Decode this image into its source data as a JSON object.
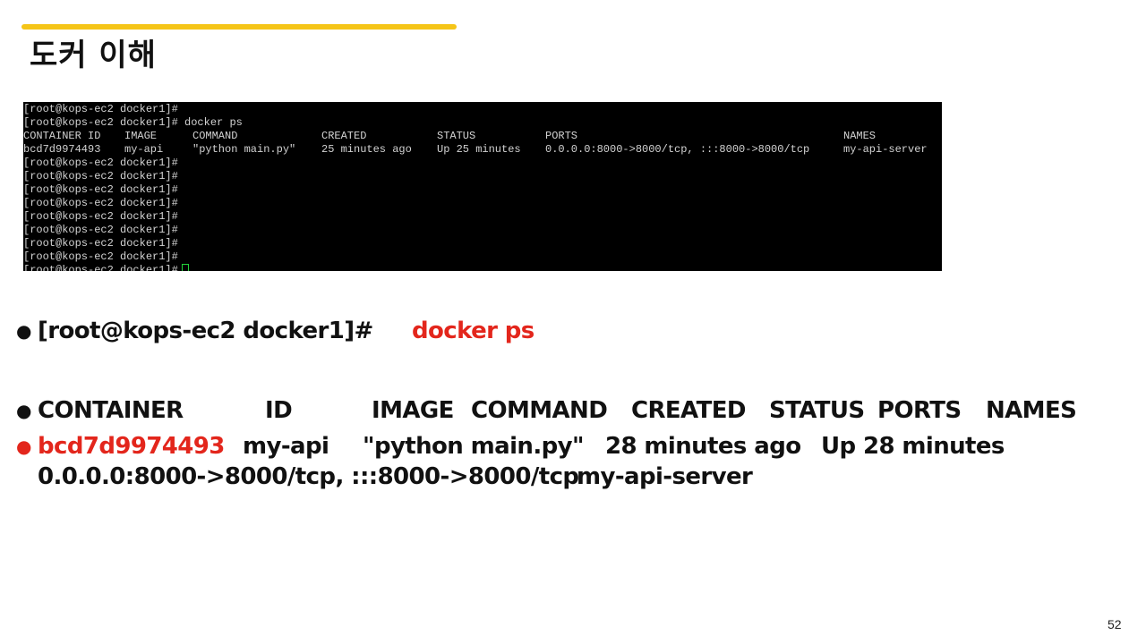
{
  "slide": {
    "title": "도커 이해",
    "page_number": "52",
    "accent_color": "#f5c518",
    "highlight_color": "#e3261c"
  },
  "terminal": {
    "background": "#000000",
    "text_color": "#d2d2d2",
    "cursor_color": "#23d23a",
    "prompt": "[root@kops-ec2 docker1]#",
    "command": "[root@kops-ec2 docker1]# docker ps",
    "headers": [
      "CONTAINER ID",
      "IMAGE",
      "COMMAND",
      "CREATED",
      "STATUS",
      "PORTS",
      "NAMES"
    ],
    "row": [
      "bcd7d9974493",
      "my-api",
      "\"python main.py\"",
      "25 minutes ago",
      "Up 25 minutes",
      "0.0.0.0:8000->8000/tcp, :::8000->8000/tcp",
      "my-api-server"
    ]
  },
  "bullets": {
    "command_prefix": "[root@kops-ec2 docker1]#",
    "command_highlight": "docker ps",
    "headers": [
      "CONTAINER",
      "ID",
      "IMAGE",
      "COMMAND",
      "CREATED",
      "STATUS",
      "PORTS",
      "NAMES"
    ],
    "row_id": "bcd7d9974493",
    "row_image": "my-api",
    "row_command": "\"python main.py\"",
    "row_created": "28 minutes ago",
    "row_status": "Up 28 minutes",
    "row_ports": "0.0.0.0:8000->8000/tcp, :::8000->8000/tcp",
    "row_names": "my-api-server"
  }
}
